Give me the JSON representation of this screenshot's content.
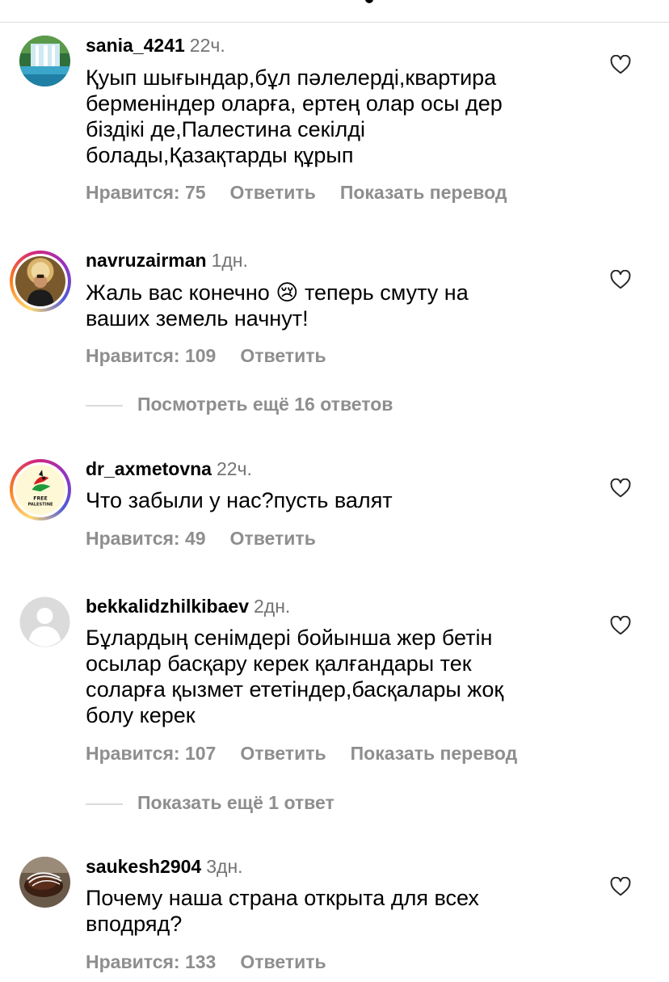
{
  "comments": [
    {
      "username": "sania_4241",
      "time": "22ч.",
      "text": "Қуып шығындар,бұл пәлелерді,квартира\nберменіндер оларға, ертең олар осы дер\nбіздікі де,Палестина секілді\nболады,Қазақтарды құрып",
      "likes": "Нравится: 75",
      "reply": "Ответить",
      "translate": "Показать перевод"
    },
    {
      "username": "navruzairman",
      "time": "1дн.",
      "text_before_emoji": "Жаль вас конечно ",
      "emoji": "😢",
      "text_after_emoji": " теперь смуту на\nваших земель начнут!",
      "likes": "Нравится: 109",
      "reply": "Ответить",
      "more_replies": "Посмотреть ещё 16 ответов"
    },
    {
      "username": "dr_axmetovna",
      "time": "22ч.",
      "text": "Что забыли у нас?пусть валят",
      "likes": "Нравится: 49",
      "reply": "Ответить",
      "avatar_text": [
        "FREE",
        "PALESTINE"
      ]
    },
    {
      "username": "bekkalidzhilkibaev",
      "time": "2дн.",
      "text": "Бұлардың сенімдері бойынша жер бетін\nосылар басқару керек қалғандары тек\nсоларға  қызмет ететіндер,басқалары жоқ\nболу керек",
      "likes": "Нравится: 107",
      "reply": "Ответить",
      "translate": "Показать перевод",
      "more_replies": "Показать ещё 1 ответ"
    },
    {
      "username": "saukesh2904",
      "time": "3дн.",
      "text": "Почему наша страна открыта для всех\nвподряд?",
      "likes": "Нравится: 133",
      "reply": "Ответить"
    }
  ],
  "icons": {
    "like": "heart-outline-icon",
    "default_avatar": "person-silhouette-icon"
  },
  "colors": {
    "text": "#000000",
    "secondary": "#8e8e8e",
    "time": "#737373",
    "divider": "#dbdbdb"
  }
}
